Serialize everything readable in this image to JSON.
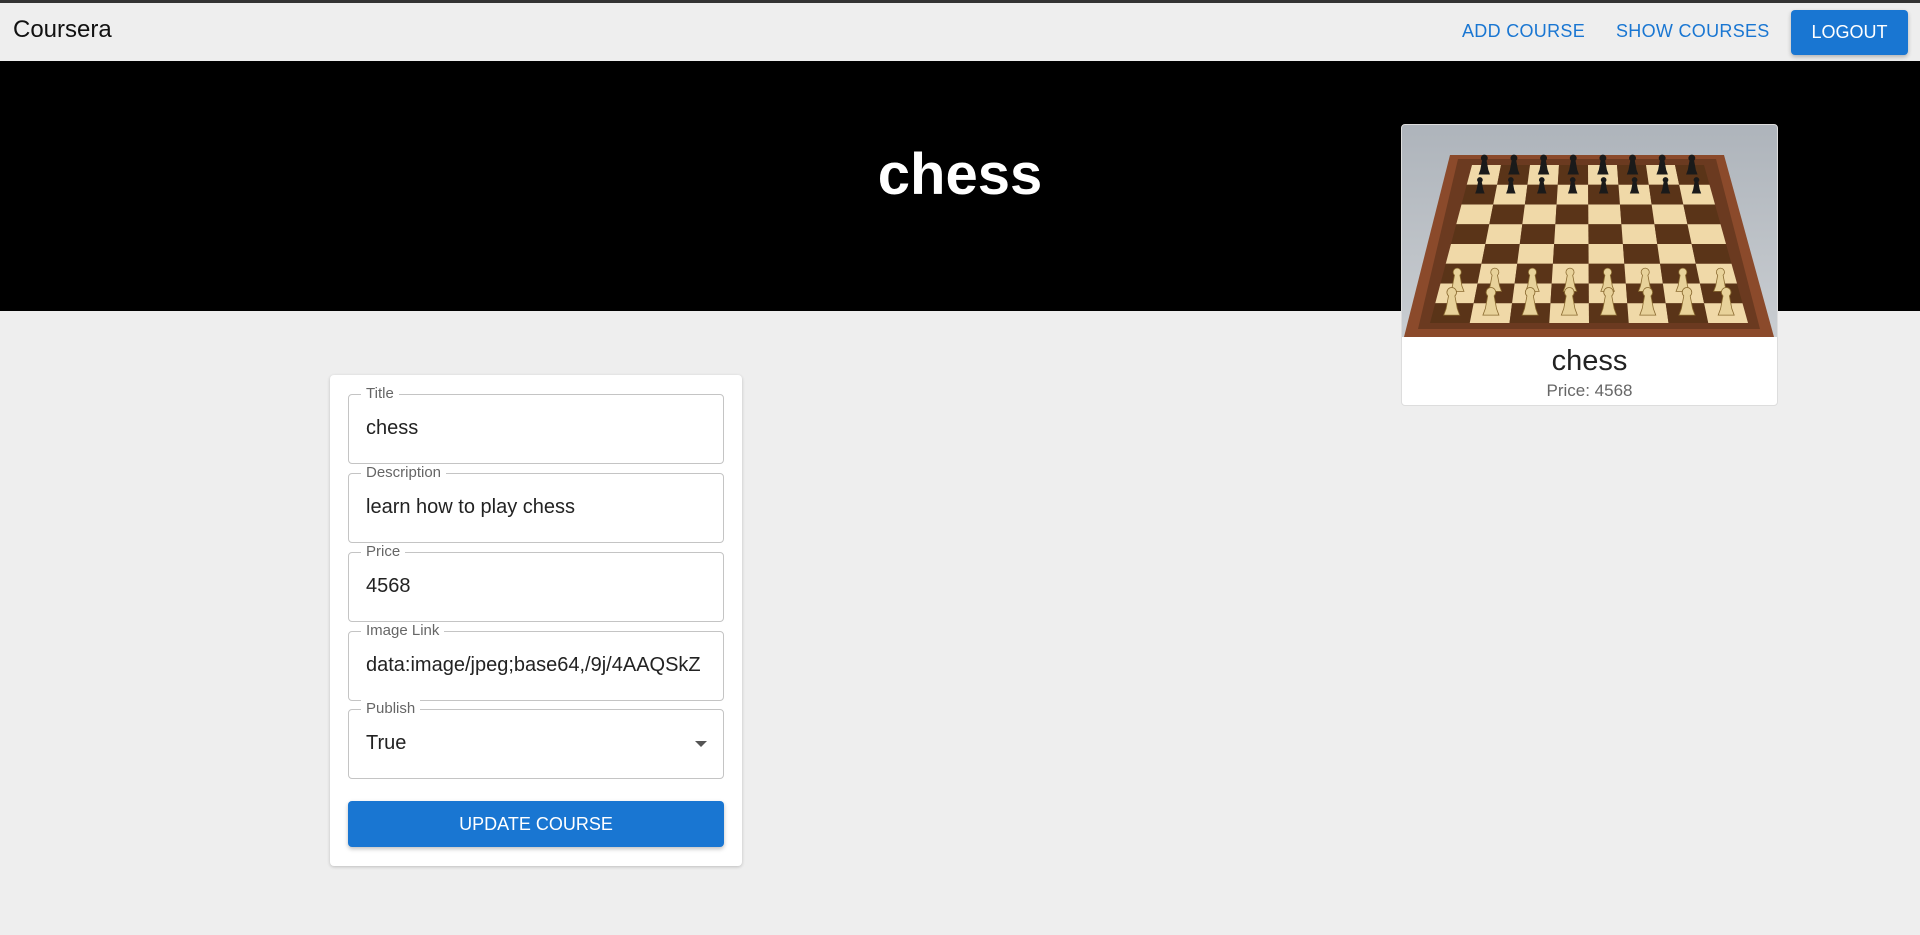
{
  "navbar": {
    "brand": "Coursera",
    "add_course": "ADD COURSE",
    "show_courses": "SHOW COURSES",
    "logout": "LOGOUT"
  },
  "hero": {
    "title": "chess"
  },
  "preview": {
    "image_icon": "chessboard-image",
    "title": "chess",
    "price": "Price: 4568"
  },
  "form": {
    "title": {
      "label": "Title",
      "value": "chess"
    },
    "description": {
      "label": "Description",
      "value": "learn how to play chess"
    },
    "price": {
      "label": "Price",
      "value": "4568"
    },
    "image_link": {
      "label": "Image Link",
      "value": "data:image/jpeg;base64,/9j/4AAQSkZ"
    },
    "publish": {
      "label": "Publish",
      "value": "True"
    },
    "submit_label": "UPDATE COURSE"
  },
  "colors": {
    "primary": "#1976d2",
    "background": "#eeeeee",
    "hero": "#000000"
  }
}
